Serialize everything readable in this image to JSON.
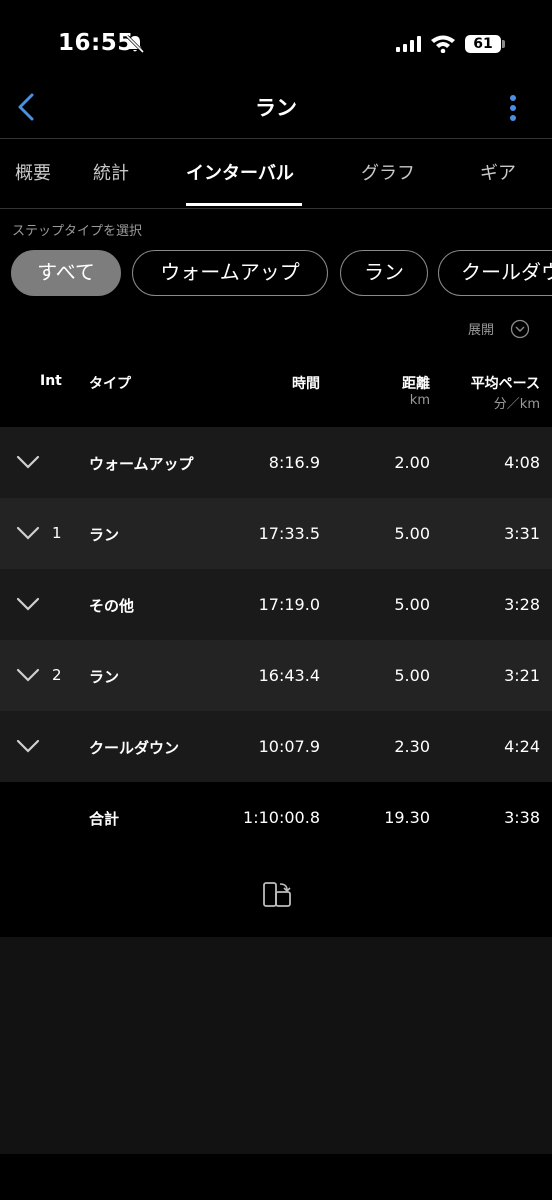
{
  "status": {
    "time": "16:55",
    "battery": "61"
  },
  "nav": {
    "title": "ラン"
  },
  "tabs": [
    {
      "label": "概要",
      "active": false
    },
    {
      "label": "統計",
      "active": false
    },
    {
      "label": "インターバル",
      "active": true
    },
    {
      "label": "グラフ",
      "active": false
    },
    {
      "label": "ギア",
      "active": false
    }
  ],
  "filter": {
    "label": "ステップタイプを選択",
    "chips": [
      "すべて",
      "ウォームアップ",
      "ラン",
      "クールダウン"
    ]
  },
  "expand_label": "展開",
  "table": {
    "headers": {
      "int": "Int",
      "type": "タイプ",
      "time": "時間",
      "distance": "距離",
      "distance_unit": "km",
      "pace": "平均ペース",
      "pace_unit": "分／km"
    },
    "rows": [
      {
        "int": "",
        "type": "ウォームアップ",
        "time": "8:16.9",
        "distance": "2.00",
        "pace": "4:08"
      },
      {
        "int": "1",
        "type": "ラン",
        "time": "17:33.5",
        "distance": "5.00",
        "pace": "3:31"
      },
      {
        "int": "",
        "type": "その他",
        "time": "17:19.0",
        "distance": "5.00",
        "pace": "3:28"
      },
      {
        "int": "2",
        "type": "ラン",
        "time": "16:43.4",
        "distance": "5.00",
        "pace": "3:21"
      },
      {
        "int": "",
        "type": "クールダウン",
        "time": "10:07.9",
        "distance": "2.30",
        "pace": "4:24"
      }
    ],
    "total": {
      "type": "合計",
      "time": "1:10:00.8",
      "distance": "19.30",
      "pace": "3:38"
    }
  },
  "colors": {
    "accent": "#4a90e2",
    "background": "#000000"
  }
}
